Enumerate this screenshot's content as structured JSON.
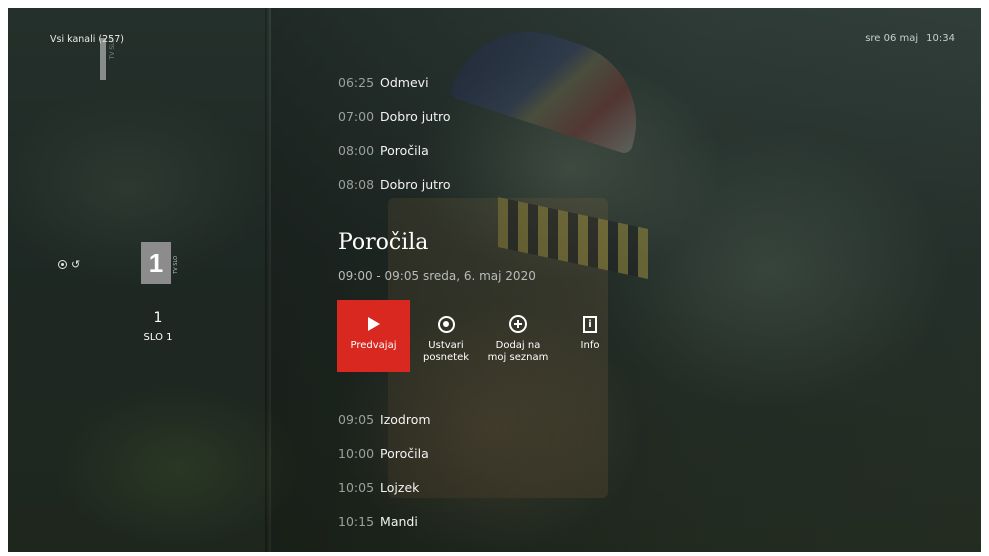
{
  "header": {
    "channels_label": "Vsi kanali (257)",
    "date": "sre 06 maj",
    "time": "10:34"
  },
  "channel": {
    "logo_text": "1",
    "logo_tag": "TV SLO",
    "number": "1",
    "name": "SLO 1",
    "status_icons": [
      "record-icon",
      "replay-icon"
    ]
  },
  "schedule_before": [
    {
      "time": "06:25",
      "title": "Odmevi"
    },
    {
      "time": "07:00",
      "title": "Dobro jutro"
    },
    {
      "time": "08:00",
      "title": "Poročila"
    },
    {
      "time": "08:08",
      "title": "Dobro jutro"
    }
  ],
  "featured": {
    "title": "Poročila",
    "subtitle": "09:00 - 09:05 sreda, 6. maj 2020"
  },
  "actions": [
    {
      "label": "Predvajaj",
      "icon": "play-icon",
      "selected": true
    },
    {
      "label": "Ustvari\nposnetek",
      "icon": "record-icon",
      "selected": false
    },
    {
      "label": "Dodaj na\nmoj seznam",
      "icon": "add-circle-icon",
      "selected": false
    },
    {
      "label": "Info",
      "icon": "info-icon",
      "selected": false
    }
  ],
  "schedule_after": [
    {
      "time": "09:05",
      "title": "Izodrom"
    },
    {
      "time": "10:00",
      "title": "Poročila"
    },
    {
      "time": "10:05",
      "title": "Lojzek"
    },
    {
      "time": "10:15",
      "title": "Mandi"
    }
  ],
  "colors": {
    "accent": "#d8281f",
    "time_text": "#9aa19c"
  }
}
